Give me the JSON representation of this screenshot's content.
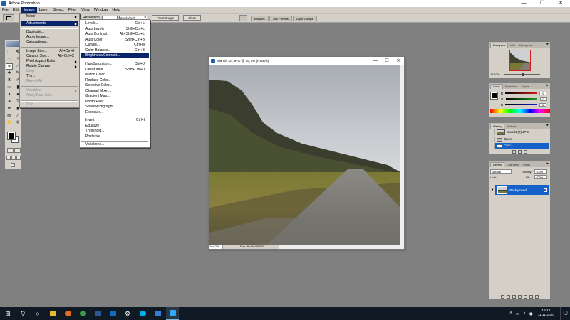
{
  "window": {
    "title": "Adobe Photoshop",
    "minimize": "—",
    "maximize": "☐",
    "close": "✕"
  },
  "menubar": [
    "File",
    "Edit",
    "Image",
    "Layer",
    "Select",
    "Filter",
    "View",
    "Window",
    "Help"
  ],
  "options": {
    "resolution_label": "Resolution:",
    "resolution_value": "",
    "units": "pixels/inch",
    "front_image": "Front Image",
    "clear": "Clear",
    "palette_tabs": [
      "Brushes",
      "Tool Presets",
      "Layer Comps"
    ]
  },
  "image_menu": {
    "items": [
      {
        "label": "Mode",
        "shortcut": "",
        "submenu": true,
        "disabled": false
      },
      {
        "label": "Adjustments",
        "shortcut": "",
        "submenu": true,
        "disabled": false,
        "highlighted": true
      },
      {
        "label": "Duplicate...",
        "shortcut": "",
        "submenu": false,
        "disabled": false
      },
      {
        "label": "Apply Image...",
        "shortcut": "",
        "submenu": false,
        "disabled": false
      },
      {
        "label": "Calculations...",
        "shortcut": "",
        "submenu": false,
        "disabled": false
      },
      {
        "label": "Image Size...",
        "shortcut": "Alt+Ctrl+I",
        "submenu": false,
        "disabled": false
      },
      {
        "label": "Canvas Size...",
        "shortcut": "Alt+Ctrl+C",
        "submenu": false,
        "disabled": false
      },
      {
        "label": "Pixel Aspect Ratio",
        "shortcut": "",
        "submenu": true,
        "disabled": false
      },
      {
        "label": "Rotate Canvas",
        "shortcut": "",
        "submenu": true,
        "disabled": false
      },
      {
        "label": "Crop",
        "shortcut": "",
        "submenu": false,
        "disabled": true
      },
      {
        "label": "Trim...",
        "shortcut": "",
        "submenu": false,
        "disabled": false
      },
      {
        "label": "Reveal All",
        "shortcut": "",
        "submenu": false,
        "disabled": true
      },
      {
        "label": "Variables",
        "shortcut": "",
        "submenu": true,
        "disabled": true
      },
      {
        "label": "Apply Data Set...",
        "shortcut": "",
        "submenu": false,
        "disabled": true
      },
      {
        "label": "Trap...",
        "shortcut": "",
        "submenu": false,
        "disabled": true
      }
    ]
  },
  "adjustments_menu": {
    "items": [
      {
        "label": "Levels...",
        "shortcut": "Ctrl+L"
      },
      {
        "label": "Auto Levels",
        "shortcut": "Shift+Ctrl+L"
      },
      {
        "label": "Auto Contrast",
        "shortcut": "Alt+Shift+Ctrl+L"
      },
      {
        "label": "Auto Color",
        "shortcut": "Shift+Ctrl+B"
      },
      {
        "label": "Curves...",
        "shortcut": "Ctrl+M"
      },
      {
        "label": "Color Balance...",
        "shortcut": "Ctrl+B"
      },
      {
        "label": "Brightness/Contrast...",
        "shortcut": "",
        "highlighted": true
      },
      {
        "label": "Hue/Saturation...",
        "shortcut": "Ctrl+U"
      },
      {
        "label": "Desaturate",
        "shortcut": "Shift+Ctrl+U"
      },
      {
        "label": "Match Color...",
        "shortcut": ""
      },
      {
        "label": "Replace Color...",
        "shortcut": ""
      },
      {
        "label": "Selective Color...",
        "shortcut": ""
      },
      {
        "label": "Channel Mixer...",
        "shortcut": ""
      },
      {
        "label": "Gradient Map...",
        "shortcut": ""
      },
      {
        "label": "Photo Filter...",
        "shortcut": ""
      },
      {
        "label": "Shadow/Highlight...",
        "shortcut": ""
      },
      {
        "label": "Exposure...",
        "shortcut": ""
      },
      {
        "label": "Invert",
        "shortcut": "Ctrl+I"
      },
      {
        "label": "Equalize",
        "shortcut": ""
      },
      {
        "label": "Threshold...",
        "shortcut": ""
      },
      {
        "label": "Posterize...",
        "shortcut": ""
      },
      {
        "label": "Variations...",
        "shortcut": ""
      }
    ]
  },
  "document": {
    "title": "island4 (2).JPG @ 16,7% (RGB/8)",
    "zoom": "16,67%",
    "doc_size": "Doc: 40,0M/40,0M",
    "minimize": "—",
    "maximize": "☐",
    "close": "✕"
  },
  "navigator": {
    "tabs": [
      "Navigator",
      "Info",
      "Histogram"
    ],
    "zoom": "16,67%"
  },
  "color_palette": {
    "tabs": [
      "Color",
      "Swatches",
      "Styles"
    ],
    "channels": [
      {
        "label": "R",
        "value": "0",
        "color": "#d01818"
      },
      {
        "label": "G",
        "value": "0",
        "color": "#18a018"
      },
      {
        "label": "B",
        "value": "0",
        "color": "#1818d0"
      }
    ]
  },
  "history": {
    "tabs": [
      "History",
      "Actions"
    ],
    "snapshot": "island4 (2).JPG",
    "states": [
      {
        "label": "Open",
        "selected": false
      },
      {
        "label": "Crop",
        "selected": true
      }
    ]
  },
  "layers": {
    "tabs": [
      "Layers",
      "Channels",
      "Paths"
    ],
    "blend_mode": "Normal",
    "opacity_label": "Opacity:",
    "opacity": "100%",
    "lock_label": "Lock:",
    "fill_label": "Fill:",
    "fill": "100%",
    "items": [
      {
        "name": "Background",
        "visible": true
      }
    ]
  },
  "taskbar": {
    "icons": [
      "windows-start-icon",
      "search-icon",
      "task-view-icon",
      "file-explorer-icon",
      "firefox-icon",
      "chrome-icon",
      "word-icon",
      "outlook-icon",
      "settings-icon",
      "skype-icon",
      "store-icon",
      "photoshop-icon"
    ],
    "time": "16:12",
    "date": "11.11.2020"
  },
  "colors": {
    "menu_highlight": "#0a246a",
    "selection": "#1561c8",
    "taskbar": "#101a24"
  }
}
